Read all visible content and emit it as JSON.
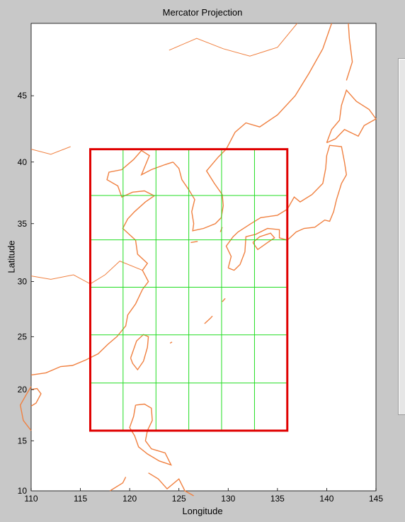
{
  "window": {
    "title": "Mercator Projection"
  },
  "chart_data": {
    "type": "map",
    "title": "Mercator Projection",
    "xlabel": "Longitude",
    "ylabel": "Latitude",
    "xlim": [
      110,
      145
    ],
    "ylim": [
      10,
      50
    ],
    "xticks": [
      110,
      115,
      120,
      125,
      130,
      135,
      140,
      145
    ],
    "yticks": [
      15,
      20,
      25,
      30,
      35,
      40,
      45
    ],
    "coastline_color": "#f08040",
    "region_box": {
      "lon": [
        116,
        136
      ],
      "lat": [
        16,
        41
      ],
      "color": "#e00000"
    },
    "grid_lines": {
      "color": "#22dd22",
      "lon": [
        119.33,
        122.67,
        126,
        129.33,
        132.67
      ],
      "lat": [
        20.63,
        25.17,
        29.5,
        33.63,
        37.33
      ]
    }
  }
}
